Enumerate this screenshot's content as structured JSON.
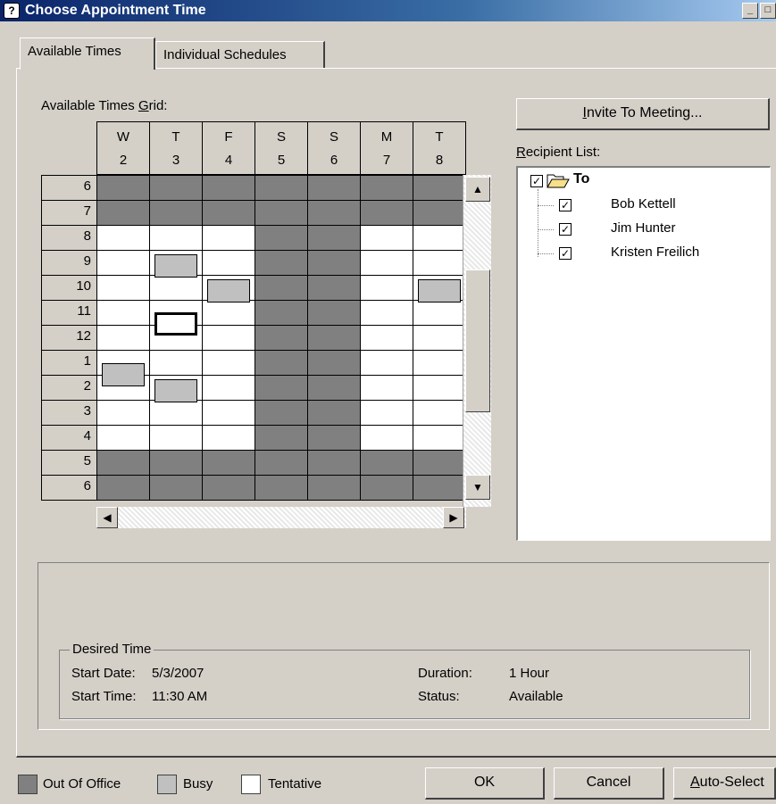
{
  "window": {
    "title": "Choose Appointment Time",
    "minimize": "_",
    "maximize": "□"
  },
  "tabs": [
    {
      "label": "Available Times",
      "active": true
    },
    {
      "label": "Individual Schedules",
      "active": false
    }
  ],
  "grid": {
    "label_prefix": "Available Times ",
    "label_hotkey": "G",
    "label_suffix": "rid:",
    "days": [
      {
        "dow": "W",
        "date": "2"
      },
      {
        "dow": "T",
        "date": "3"
      },
      {
        "dow": "F",
        "date": "4"
      },
      {
        "dow": "S",
        "date": "5"
      },
      {
        "dow": "S",
        "date": "6"
      },
      {
        "dow": "M",
        "date": "7"
      },
      {
        "dow": "T",
        "date": "8"
      }
    ],
    "hours": [
      "6",
      "7",
      "8",
      "9",
      "10",
      "11",
      "12",
      "1",
      "2",
      "3",
      "4",
      "5",
      "6"
    ]
  },
  "recipients": {
    "invite_prefix": "",
    "invite_hotkey": "I",
    "invite_suffix": "nvite To Meeting...",
    "list_hotkey": "R",
    "list_suffix": "ecipient List:",
    "root": "To",
    "items": [
      "Bob Kettell",
      "Jim Hunter",
      "Kristen Freilich"
    ]
  },
  "desired_time": {
    "legend": "Desired Time",
    "start_date_label": "Start Date:",
    "start_date": "5/3/2007",
    "start_time_label": "Start Time:",
    "start_time": "11:30 AM",
    "duration_label": "Duration:",
    "duration": "1 Hour",
    "status_label": "Status:",
    "status": "Available"
  },
  "legend": {
    "out_of_office": "Out Of Office",
    "busy": "Busy",
    "tentative": "Tentative",
    "colors": {
      "out_of_office": "#808080",
      "busy": "#c0c0c0",
      "tentative": "#ffffff"
    }
  },
  "buttons": {
    "ok": "OK",
    "cancel": "Cancel",
    "auto_hotkey": "A",
    "auto_suffix": "uto-Select"
  }
}
